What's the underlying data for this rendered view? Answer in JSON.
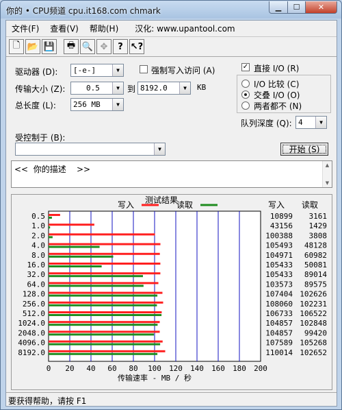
{
  "window": {
    "title": "你的 • CPU频道 cpu.it168.com chmark",
    "min_icon": "minimize-icon",
    "max_icon": "maximize-icon",
    "close_icon": "close-icon"
  },
  "menu": {
    "items": [
      "文件(F)",
      "查看(V)",
      "帮助(H)"
    ],
    "localize": "汉化: www.upantool.com"
  },
  "toolbar": [
    "new-file-icon",
    "open-folder-icon",
    "save-disk-icon",
    "print-icon",
    "print-preview-icon",
    "move-crosshair-icon",
    "help-question-icon",
    "context-help-icon"
  ],
  "form": {
    "drive_label": "驱动器 (D):",
    "drive_value": "[-e-]",
    "force_write_label": "强制写入访问 (A)",
    "direct_io_label": "直接 I/O (R)",
    "direct_io_checked": "✓",
    "transfer_label": "传输大小 (Z):",
    "transfer_from": "0.5",
    "to_label": "到",
    "transfer_to": "8192.0",
    "transfer_unit": "KB",
    "io_compare_label": "I/O 比较 (C)",
    "overlap_io_label": "交叠 I/O (O)",
    "neither_label": "两者都不 (N)",
    "total_length_label": "总长度 (L):",
    "total_length_value": "256 MB",
    "queue_depth_label": "队列深度 (Q):",
    "queue_depth_value": "4",
    "controlled_by_label": "受控制于 (B):",
    "controlled_by_value": "",
    "start_button": "开始 (S)",
    "description": "<<  你的描述    >>"
  },
  "results": {
    "title": "测试结果",
    "legend_write": "写入",
    "legend_read": "读取",
    "col_write": "写入",
    "col_read": "读取",
    "write_color": "#ff2020",
    "read_color": "#1f8c1f",
    "grid_color": "#1010c0",
    "x_axis_label": "传输速率 - MB / 秒"
  },
  "chart_data": {
    "type": "bar",
    "orientation": "horizontal",
    "categories": [
      "0.5",
      "1.0",
      "2.0",
      "4.0",
      "8.0",
      "16.0",
      "32.0",
      "64.0",
      "128.0",
      "256.0",
      "512.0",
      "1024.0",
      "2048.0",
      "4096.0",
      "8192.0"
    ],
    "series": [
      {
        "name": "写入",
        "values": [
          10899,
          43156,
          100388,
          105493,
          104971,
          105433,
          105433,
          103573,
          107404,
          108060,
          106733,
          104857,
          104857,
          107589,
          110014
        ]
      },
      {
        "name": "读取",
        "values": [
          3161,
          1429,
          3808,
          48128,
          60982,
          50081,
          89014,
          89575,
          102626,
          102231,
          106522,
          102848,
          99420,
          105268,
          102652
        ]
      }
    ],
    "xlim": [
      0,
      200
    ],
    "xticks": [
      0,
      20,
      40,
      60,
      80,
      100,
      120,
      140,
      160,
      180,
      200
    ],
    "xlabel": "传输速率 - MB / 秒",
    "value_unit_scale": 1000,
    "grid": true,
    "legend": "top-center"
  },
  "status": {
    "text": "要获得帮助，请按 F1"
  }
}
